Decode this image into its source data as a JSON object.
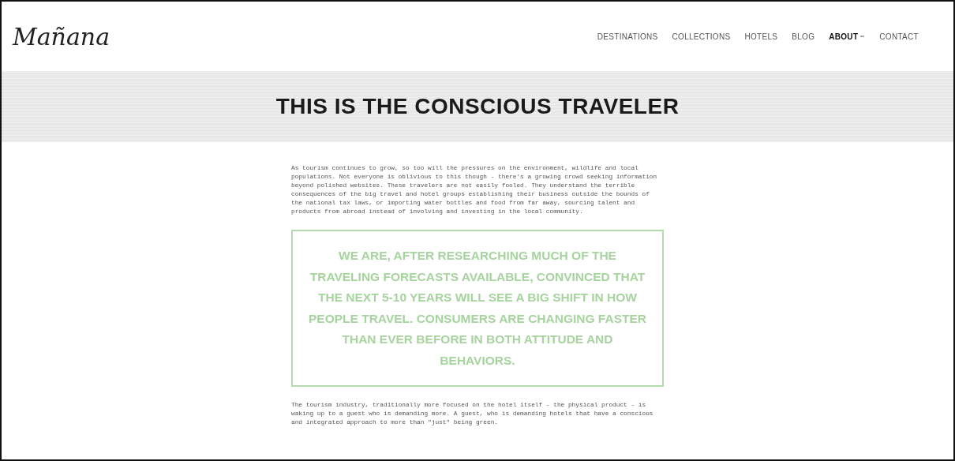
{
  "logo": "Mañana",
  "nav": [
    {
      "label": "DESTINATIONS",
      "selected": false,
      "dropdown": false
    },
    {
      "label": "COLLECTIONS",
      "selected": false,
      "dropdown": false
    },
    {
      "label": "HOTELS",
      "selected": false,
      "dropdown": false
    },
    {
      "label": "BLOG",
      "selected": false,
      "dropdown": false
    },
    {
      "label": "ABOUT",
      "selected": true,
      "dropdown": true
    },
    {
      "label": "CONTACT",
      "selected": false,
      "dropdown": false
    }
  ],
  "title": "THIS IS THE CONSCIOUS TRAVELER",
  "intro": "As tourism continues to grow, so too will the pressures on the environment, wildlife and local populations. Not everyone is oblivious to this though - there's a growing crowd seeking information beyond polished websites. These travelers are not easily fooled. They understand the terrible consequences of the big travel and hotel groups establishing their business outside the bounds of the national tax laws, or importing water bottles and food from far away, sourcing talent and products from abroad instead of involving and investing in the local community.",
  "quote": "WE ARE, AFTER RESEARCHING MUCH OF THE TRAVELING FORECASTS AVAILABLE, CONVINCED THAT THE NEXT 5-10 YEARS WILL SEE A BIG SHIFT IN HOW PEOPLE TRAVEL. CONSUMERS ARE CHANGING FASTER THAN EVER BEFORE IN BOTH ATTITUDE AND BEHAVIORS.",
  "outro": "The tourism industry, traditionally more focused on the hotel itself - the physical product - is waking up to a guest who is demanding more. A guest, who is demanding hotels that have a conscious and integrated approach to more than \"just\" being green."
}
